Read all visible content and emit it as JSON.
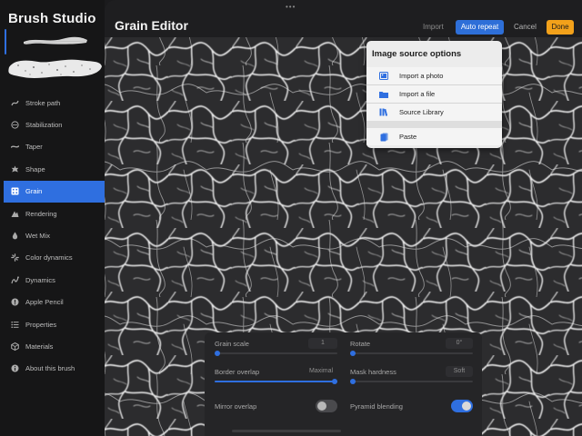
{
  "sidebar": {
    "app_title": "Brush Studio",
    "items": [
      {
        "label": "Stroke path",
        "icon": "stroke-path-icon"
      },
      {
        "label": "Stabilization",
        "icon": "stabilization-icon"
      },
      {
        "label": "Taper",
        "icon": "taper-icon"
      },
      {
        "label": "Shape",
        "icon": "shape-icon"
      },
      {
        "label": "Grain",
        "icon": "grain-icon",
        "active": true
      },
      {
        "label": "Rendering",
        "icon": "rendering-icon"
      },
      {
        "label": "Wet Mix",
        "icon": "droplet-icon"
      },
      {
        "label": "Color dynamics",
        "icon": "color-dynamics-icon"
      },
      {
        "label": "Dynamics",
        "icon": "dynamics-icon"
      },
      {
        "label": "Apple Pencil",
        "icon": "pencil-icon"
      },
      {
        "label": "Properties",
        "icon": "properties-icon"
      },
      {
        "label": "Materials",
        "icon": "cube-icon"
      },
      {
        "label": "About this brush",
        "icon": "info-icon"
      }
    ]
  },
  "header": {
    "title": "Grain Editor",
    "import_label": "Import",
    "auto_repeat_label": "Auto repeat",
    "cancel_label": "Cancel",
    "done_label": "Done"
  },
  "menu": {
    "title": "Image source options",
    "items": [
      {
        "label": "Import a photo",
        "icon": "photo-icon"
      },
      {
        "label": "Import a file",
        "icon": "folder-icon"
      },
      {
        "label": "Source Library",
        "icon": "library-icon"
      },
      {
        "label": "Paste",
        "icon": "paste-icon"
      }
    ]
  },
  "controls": {
    "grain_scale": {
      "label": "Grain scale",
      "value": "1",
      "level": 0.0
    },
    "rotate": {
      "label": "Rotate",
      "value": "0°",
      "level": 0.0
    },
    "border_overlap": {
      "label": "Border overlap",
      "value": "Maximal",
      "level": 1.0
    },
    "mask_hardness": {
      "label": "Mask hardness",
      "value": "Soft",
      "level": 0.0
    },
    "mirror_overlap": {
      "label": "Mirror overlap",
      "on": false
    },
    "pyramid_blending": {
      "label": "Pyramid blending",
      "on": true
    }
  },
  "colors": {
    "accent": "#2f6fe0",
    "done": "#f2a11a",
    "sidebar_bg": "#161617"
  }
}
